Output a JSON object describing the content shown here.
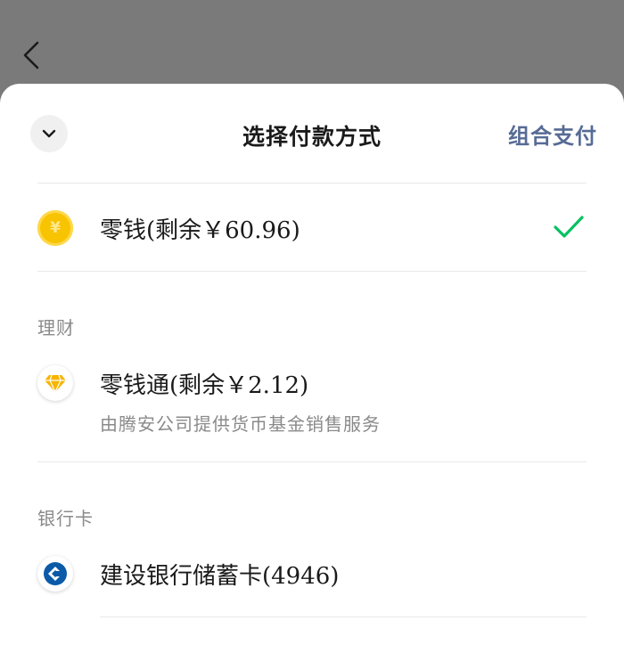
{
  "header": {
    "title": "选择付款方式",
    "combo_label": "组合支付"
  },
  "balance": {
    "label": "零钱(剩余￥60.96)",
    "coin_symbol": "¥",
    "selected": true
  },
  "finance_section": {
    "title": "理财",
    "item": {
      "label": "零钱通(剩余￥2.12)",
      "subtitle": "由腾安公司提供货币基金销售服务"
    }
  },
  "bank_section": {
    "title": "银行卡",
    "item": {
      "label": "建设银行储蓄卡(4946)"
    }
  },
  "colors": {
    "accent_link": "#576b95",
    "check_green": "#07c160",
    "coin_yellow": "#f8c300",
    "diamond_yellow": "#f7b500",
    "ccb_blue": "#0a5aa8"
  },
  "icons": {
    "back": "chevron-left-icon",
    "collapse": "chevron-down-icon",
    "balance": "yuan-coin-icon",
    "finance": "diamond-icon",
    "bank": "ccb-logo-icon",
    "selected": "checkmark-icon"
  }
}
